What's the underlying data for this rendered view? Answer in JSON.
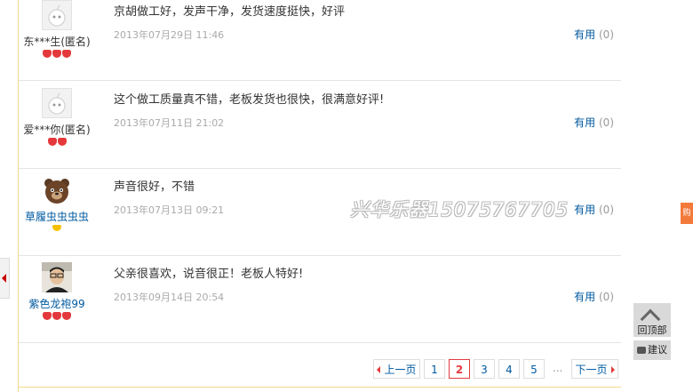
{
  "reviews": [
    {
      "user": "东***生(匿名)",
      "anonymous": true,
      "badge": "red",
      "badge_count": 3,
      "content": "京胡做工好，发声干净，发货速度挺快，好评",
      "time": "2013年07月29日 11:46",
      "useful_label": "有用",
      "useful_count": "(0)"
    },
    {
      "user": "爱***你(匿名)",
      "anonymous": true,
      "badge": "red",
      "badge_count": 2,
      "content": "这个做工质量真不错，老板发货也很快，很满意好评!",
      "time": "2013年07月11日 21:02",
      "useful_label": "有用",
      "useful_count": "(0)"
    },
    {
      "user": "草履虫虫虫虫",
      "anonymous": false,
      "badge": "gold",
      "badge_count": 1,
      "content": "声音很好，不错",
      "time": "2013年07月13日 09:21",
      "useful_label": "有用",
      "useful_count": "(0)"
    },
    {
      "user": "紫色龙袍99",
      "anonymous": false,
      "badge": "red",
      "badge_count": 3,
      "content": "父亲很喜欢，说音很正！老板人特好!",
      "time": "2013年09月14日 20:54",
      "useful_label": "有用",
      "useful_count": "(0)"
    }
  ],
  "watermark": "兴华乐器15075767705",
  "pagination": {
    "prev": "上一页",
    "pages": [
      "1",
      "2",
      "3",
      "4",
      "5"
    ],
    "current": "2",
    "ellipsis": "...",
    "next": "下一页"
  },
  "side": {
    "to_top": "回顶部",
    "suggest": "建议",
    "tab": "购"
  },
  "colors": {
    "link": "#005aa0",
    "accent": "#e4393c",
    "muted": "#aaaaaa"
  }
}
